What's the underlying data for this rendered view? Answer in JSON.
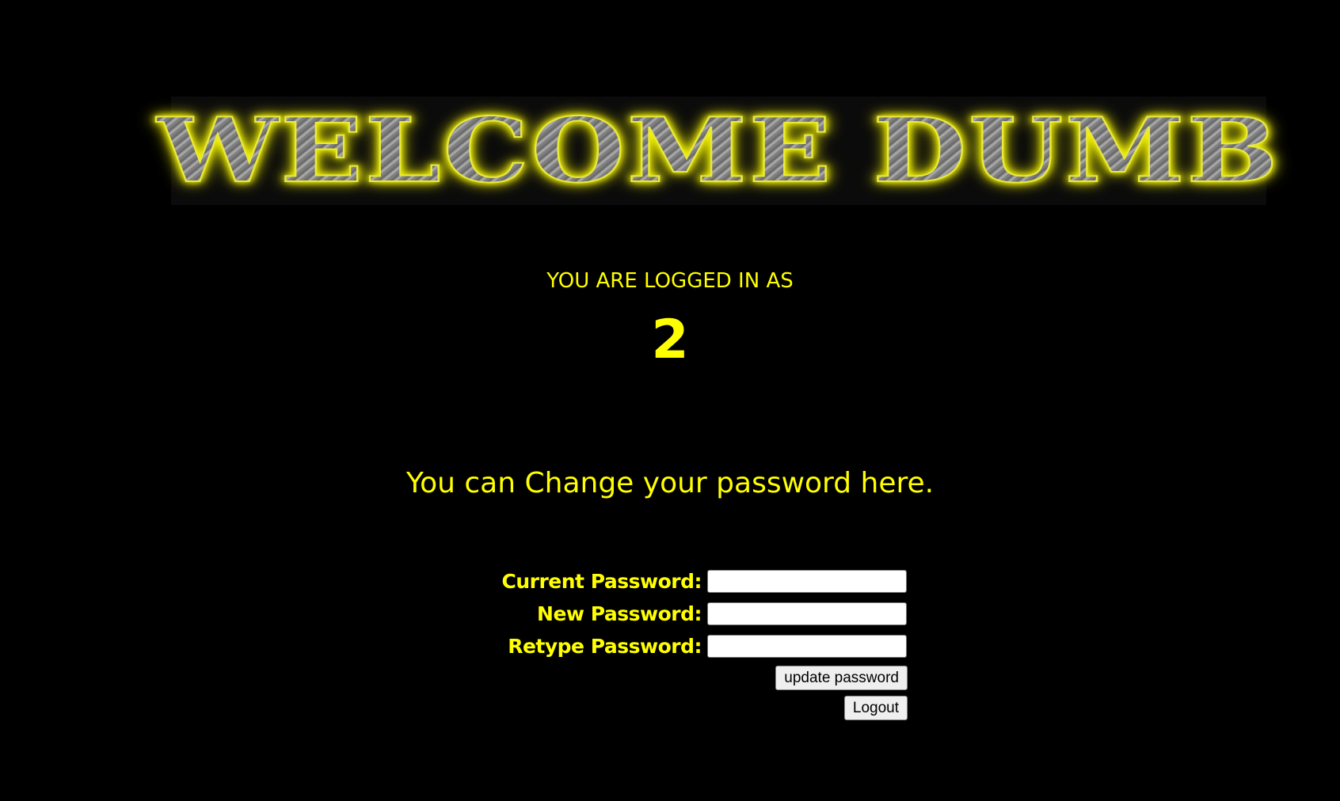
{
  "logo": {
    "text": "WELCOME DUMB"
  },
  "status": {
    "label": "YOU ARE LOGGED IN AS",
    "user": "2"
  },
  "heading": "You can Change your password here.",
  "form": {
    "current_label": "Current Password:",
    "current_value": "",
    "new_label": "New Password:",
    "new_value": "",
    "retype_label": "Retype Password:",
    "retype_value": "",
    "update_button": "update password",
    "logout_button": "Logout"
  }
}
